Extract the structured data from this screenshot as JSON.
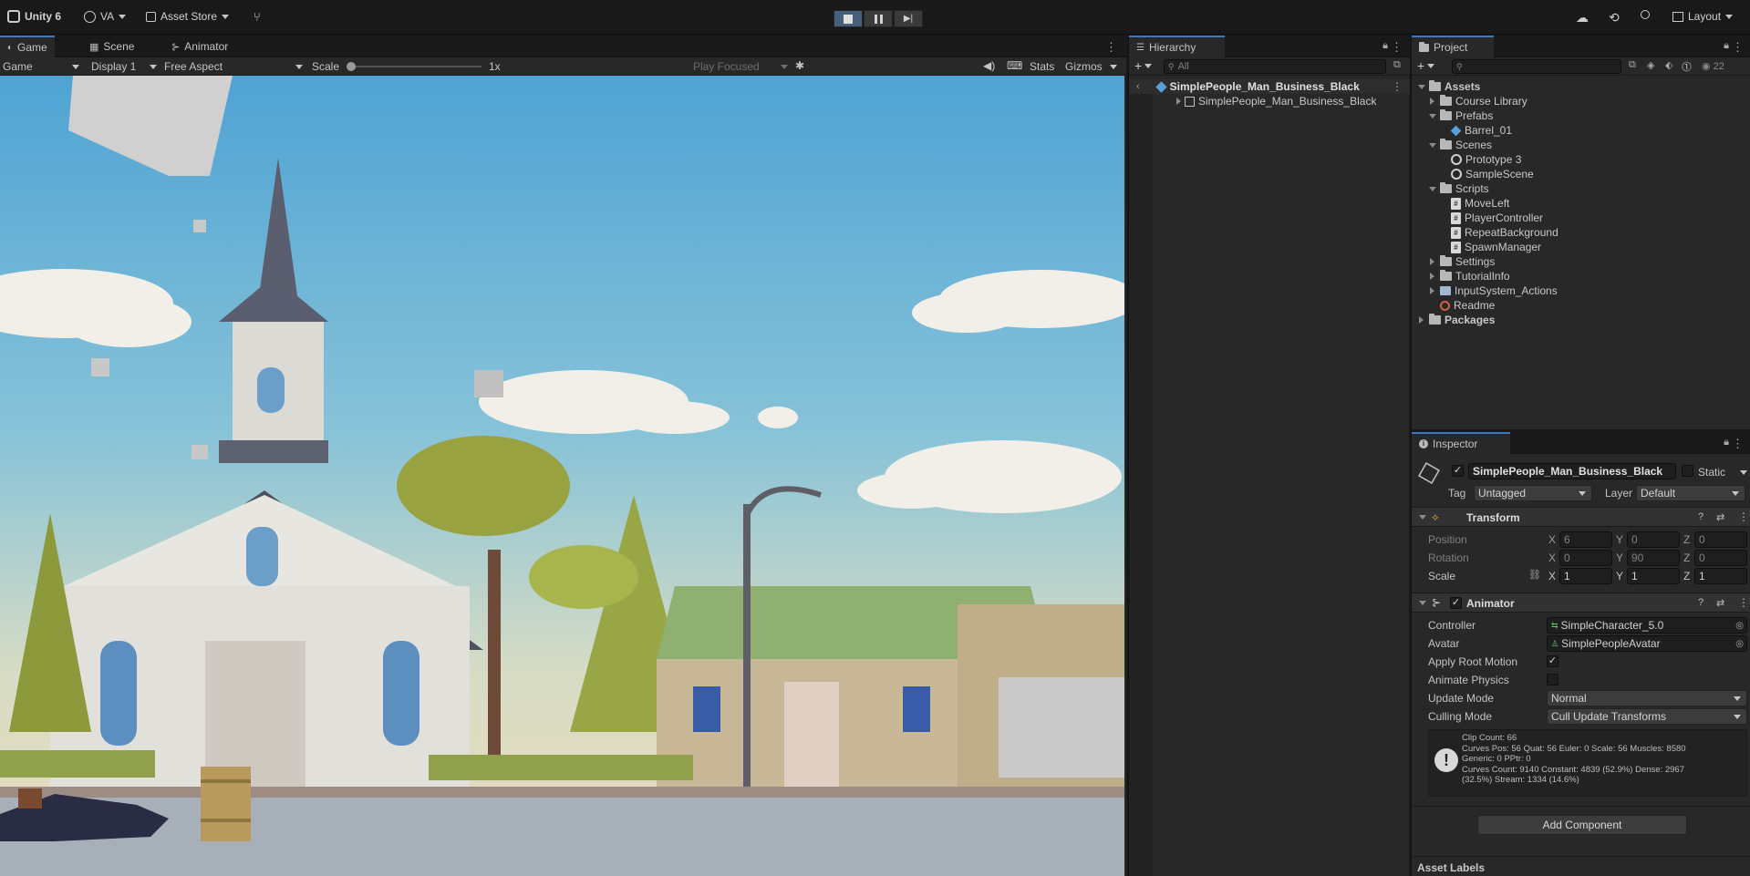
{
  "toolbar": {
    "app": "Unity 6",
    "account": "VA",
    "asset_store": "Asset Store",
    "layout": "Layout"
  },
  "game_panel": {
    "tabs": [
      {
        "label": "Game",
        "icon": "gamepad-icon"
      },
      {
        "label": "Scene",
        "icon": "grid-icon"
      },
      {
        "label": "Animator",
        "icon": "animator-icon"
      }
    ],
    "mode": "Game",
    "display": "Display 1",
    "aspect": "Free Aspect",
    "scale_label": "Scale",
    "scale_value": "1x",
    "play_focus": "Play Focused",
    "stats": "Stats",
    "gizmos": "Gizmos"
  },
  "hierarchy": {
    "title": "Hierarchy",
    "search_placeholder": "All",
    "root": "SimplePeople_Man_Business_Black",
    "child": "SimplePeople_Man_Business_Black"
  },
  "project": {
    "title": "Project",
    "hidden_count": "22",
    "tree": [
      {
        "label": "Assets",
        "type": "folder",
        "depth": 0,
        "state": "open",
        "bold": true
      },
      {
        "label": "Course Library",
        "type": "folder",
        "depth": 1,
        "state": "closed"
      },
      {
        "label": "Prefabs",
        "type": "folder",
        "depth": 1,
        "state": "open"
      },
      {
        "label": "Barrel_01",
        "type": "prefab",
        "depth": 2,
        "state": "none"
      },
      {
        "label": "Scenes",
        "type": "folder",
        "depth": 1,
        "state": "open"
      },
      {
        "label": "Prototype 3",
        "type": "scene",
        "depth": 2,
        "state": "none"
      },
      {
        "label": "SampleScene",
        "type": "scene",
        "depth": 2,
        "state": "none"
      },
      {
        "label": "Scripts",
        "type": "folder",
        "depth": 1,
        "state": "open"
      },
      {
        "label": "MoveLeft",
        "type": "script",
        "depth": 2,
        "state": "none"
      },
      {
        "label": "PlayerController",
        "type": "script",
        "depth": 2,
        "state": "none"
      },
      {
        "label": "RepeatBackground",
        "type": "script",
        "depth": 2,
        "state": "none"
      },
      {
        "label": "SpawnManager",
        "type": "script",
        "depth": 2,
        "state": "none"
      },
      {
        "label": "Settings",
        "type": "folder",
        "depth": 1,
        "state": "closed"
      },
      {
        "label": "TutorialInfo",
        "type": "folder",
        "depth": 1,
        "state": "closed"
      },
      {
        "label": "InputSystem_Actions",
        "type": "input",
        "depth": 1,
        "state": "closed"
      },
      {
        "label": "Readme",
        "type": "readme",
        "depth": 1,
        "state": "none"
      },
      {
        "label": "Packages",
        "type": "folder",
        "depth": 0,
        "state": "closed",
        "bold": true
      }
    ]
  },
  "inspector": {
    "title": "Inspector",
    "object_name": "SimplePeople_Man_Business_Black",
    "static_label": "Static",
    "tag_label": "Tag",
    "tag_value": "Untagged",
    "layer_label": "Layer",
    "layer_value": "Default",
    "transform": {
      "title": "Transform",
      "position_label": "Position",
      "rotation_label": "Rotation",
      "scale_label": "Scale",
      "position": {
        "x": "6",
        "y": "0",
        "z": "0"
      },
      "rotation": {
        "x": "0",
        "y": "90",
        "z": "0"
      },
      "scale": {
        "x": "1",
        "y": "1",
        "z": "1"
      },
      "axis_x": "X",
      "axis_y": "Y",
      "axis_z": "Z"
    },
    "animator": {
      "title": "Animator",
      "controller_label": "Controller",
      "controller_value": "SimpleCharacter_5.0",
      "avatar_label": "Avatar",
      "avatar_value": "SimplePeopleAvatar",
      "apply_root_label": "Apply Root Motion",
      "apply_root_checked": true,
      "animate_physics_label": "Animate Physics",
      "animate_physics_checked": false,
      "update_mode_label": "Update Mode",
      "update_mode_value": "Normal",
      "culling_mode_label": "Culling Mode",
      "culling_mode_value": "Cull Update Transforms",
      "info_lines": [
        "Clip Count: 66",
        "Curves Pos: 56 Quat: 56 Euler: 0 Scale: 56 Muscles: 8580",
        "Generic: 0 PPtr: 0",
        "Curves Count: 9140 Constant: 4839 (52.9%) Dense: 2967",
        "(32.5%) Stream: 1334 (14.6%)"
      ]
    },
    "add_component": "Add Component",
    "asset_labels": "Asset Labels"
  },
  "colors": {
    "accent": "#3a79bb",
    "panel": "#282828",
    "background": "#191919",
    "play_active": "#46607c"
  }
}
